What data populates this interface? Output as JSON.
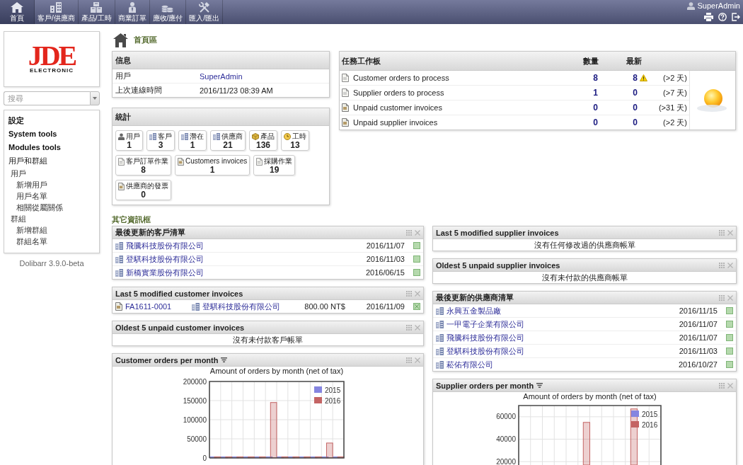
{
  "top_menu": [
    {
      "kind": "home",
      "label": "首頁",
      "selected": true
    },
    {
      "kind": "company",
      "label": "客戶/供應商",
      "selected": false
    },
    {
      "kind": "product",
      "label": "產品/工時",
      "selected": false
    },
    {
      "kind": "order",
      "label": "商業訂單",
      "selected": false
    },
    {
      "kind": "billing",
      "label": "應收/應付",
      "selected": false
    },
    {
      "kind": "tools",
      "label": "匯入/匯出",
      "selected": false
    }
  ],
  "user_bar": {
    "user": "SuperAdmin"
  },
  "sidebar": {
    "logo": {
      "mark": "JDE",
      "caption": "ELECTRONIC"
    },
    "search": {
      "placeholder": "搜尋"
    },
    "menu": [
      {
        "label": "設定"
      },
      {
        "label": "System tools"
      },
      {
        "label": "Modules tools"
      },
      {
        "label": "用戶和群組",
        "children": [
          {
            "label": "用戶",
            "children": [
              {
                "label": "新增用戶"
              },
              {
                "label": "用戶名單"
              },
              {
                "label": "相關從屬關係"
              }
            ]
          },
          {
            "label": "群組",
            "children": [
              {
                "label": "新增群組"
              },
              {
                "label": "群組名單"
              }
            ]
          }
        ]
      }
    ],
    "version": "Dolibarr 3.9.0-beta"
  },
  "page_title": "首頁區",
  "info": {
    "title": "信息",
    "rows": [
      {
        "label": "用戶",
        "value": "SuperAdmin",
        "kind": "link"
      },
      {
        "label": "上次連線時間",
        "value": "2016/11/23 08:39 AM",
        "kind": "text"
      }
    ]
  },
  "stats": {
    "title": "統計",
    "tiles": [
      {
        "kind": "user",
        "label": "用戶",
        "count": "1"
      },
      {
        "kind": "company",
        "label": "客戶",
        "count": "3"
      },
      {
        "kind": "company",
        "label": "潛在",
        "count": "1"
      },
      {
        "kind": "company",
        "label": "供應商",
        "count": "21"
      },
      {
        "kind": "product",
        "label": "產品",
        "count": "136"
      },
      {
        "kind": "time",
        "label": "工時",
        "count": "13"
      },
      {
        "kind": "order",
        "label": "客戶訂單作業",
        "count": "8"
      },
      {
        "kind": "invoice",
        "label": "Customers invoices",
        "count": "1"
      },
      {
        "kind": "order",
        "label": "採購作業",
        "count": "19"
      },
      {
        "kind": "invoice",
        "label": "供應商的發票",
        "count": "0"
      }
    ]
  },
  "task_board": {
    "title": "任務工作板",
    "columns": [
      "數量",
      "最新"
    ],
    "rows": [
      {
        "kind": "order",
        "label": "Customer orders to process",
        "count": "8",
        "latest": "8",
        "warning": true,
        "delay": "(>2 天)"
      },
      {
        "kind": "order",
        "label": "Supplier orders to process",
        "count": "1",
        "latest": "0",
        "warning": false,
        "delay": "(>7 天)"
      },
      {
        "kind": "invoice",
        "label": "Unpaid customer invoices",
        "count": "0",
        "latest": "0",
        "warning": false,
        "delay": "(>31 天)"
      },
      {
        "kind": "invoice",
        "label": "Unpaid supplier invoices",
        "count": "0",
        "latest": "0",
        "warning": false,
        "delay": "(>2 天)"
      }
    ]
  },
  "other_boxes": {
    "title": "其它資訊框",
    "left": [
      {
        "kind": "companies",
        "title": "最後更新的客戶清單",
        "rows": [
          {
            "name": "飛騰科技股份有限公司",
            "date": "2016/11/07"
          },
          {
            "name": "登騏科技股份有限公司",
            "date": "2016/11/03"
          },
          {
            "name": "新橋實業股份有限公司",
            "date": "2016/06/15"
          }
        ]
      },
      {
        "kind": "invoices",
        "title": "Last 5 modified customer invoices",
        "rows": [
          {
            "ref": "FA1611-0001",
            "company": "登騏科技股份有限公司",
            "amount": "800.00 NT$",
            "date": "2016/11/09"
          }
        ]
      },
      {
        "kind": "empty",
        "title": "Oldest 5 unpaid customer invoices",
        "message": "沒有未付款客戶帳單"
      },
      {
        "kind": "chart",
        "title": "Customer orders per month",
        "chart_data": {
          "type": "bar",
          "title": "Amount of orders by month (net of tax)",
          "series": [
            {
              "name": "2015",
              "color": "#8585e0",
              "values": [
                0,
                0,
                0,
                0,
                0,
                0,
                0,
                0,
                0,
                0,
                0,
                0
              ]
            },
            {
              "name": "2016",
              "color": "#c46464",
              "values": [
                0,
                0,
                0,
                0,
                0,
                145000,
                0,
                0,
                0,
                0,
                39000,
                0
              ]
            }
          ],
          "ylim": [
            0,
            200000
          ],
          "yticks": [
            {
              "value": 0,
              "label": "0"
            },
            50000,
            100000,
            150000,
            200000
          ],
          "grid": true,
          "legend": true
        }
      }
    ],
    "right": [
      {
        "kind": "empty",
        "title": "Last 5 modified supplier invoices",
        "message": "沒有任何修改過的供應商帳單"
      },
      {
        "kind": "empty",
        "title": "Oldest 5 unpaid supplier invoices",
        "message": "沒有未付款的供應商帳單"
      },
      {
        "kind": "companies",
        "title": "最後更新的供應商清單",
        "rows": [
          {
            "name": "永興五金製品廠",
            "date": "2016/11/15"
          },
          {
            "name": "一甲電子企業有限公司",
            "date": "2016/11/07"
          },
          {
            "name": "飛騰科技股份有限公司",
            "date": "2016/11/07"
          },
          {
            "name": "登騏科技股份有限公司",
            "date": "2016/11/03"
          },
          {
            "name": "菘佑有限公司",
            "date": "2016/10/27"
          }
        ]
      },
      {
        "kind": "chart",
        "title": "Supplier orders per month",
        "chart_data": {
          "type": "bar",
          "title": "Amount of orders by month (net of tax)",
          "series": [
            {
              "name": "2015",
              "color": "#8585e0",
              "values": [
                null,
                null,
                null,
                null,
                null,
                null,
                null,
                null,
                null,
                null,
                null,
                null
              ]
            },
            {
              "name": "2016",
              "color": "#c46464",
              "values": [
                null,
                null,
                null,
                null,
                null,
                55000,
                null,
                null,
                null,
                67000,
                null,
                null
              ]
            }
          ],
          "ylim": [
            17000,
            70000
          ],
          "yticks": [
            20000,
            40000,
            60000
          ],
          "grid": true,
          "legend": true
        }
      }
    ]
  }
}
